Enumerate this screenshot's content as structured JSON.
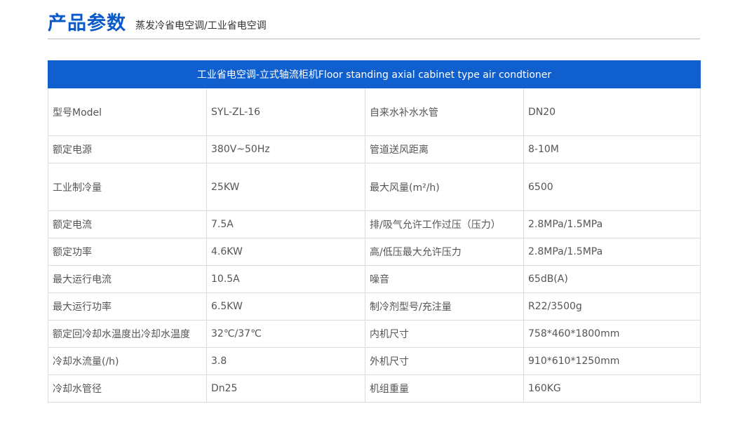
{
  "header": {
    "title": "产品参数",
    "subtitle": "蒸发冷省电空调/工业省电空调"
  },
  "table": {
    "caption": "工业省电空调-立式轴流柜机Floor standing axial cabinet type air condtioner",
    "rows": [
      [
        "型号Model",
        "SYL-ZL-16",
        "自来水补水水管",
        "DN20"
      ],
      [
        "额定电源",
        "380V~50Hz",
        "管道送风距离",
        "8-10M"
      ],
      [
        "工业制冷量",
        "25KW",
        "最大风量(m²/h)",
        "6500"
      ],
      [
        "额定电流",
        "7.5A",
        "排/吸气允许工作过压（压力）",
        "2.8MPa/1.5MPa"
      ],
      [
        "额定功率",
        "4.6KW",
        "高/低压最大允许压力",
        "2.8MPa/1.5MPa"
      ],
      [
        "最大运行电流",
        "10.5A",
        "噪音",
        "65dB(A)"
      ],
      [
        "最大运行功率",
        "6.5KW",
        "制冷剂型号/充注量",
        "R22/3500g"
      ],
      [
        "额定回冷却水温度出冷却水温度",
        "32℃/37℃",
        "内机尺寸",
        "758*460*1800mm"
      ],
      [
        "冷却水流量(/h)",
        "3.8",
        "外机尺寸",
        "910*610*1250mm"
      ],
      [
        "冷却水管径",
        "Dn25",
        "机组重量",
        "160KG"
      ]
    ]
  }
}
